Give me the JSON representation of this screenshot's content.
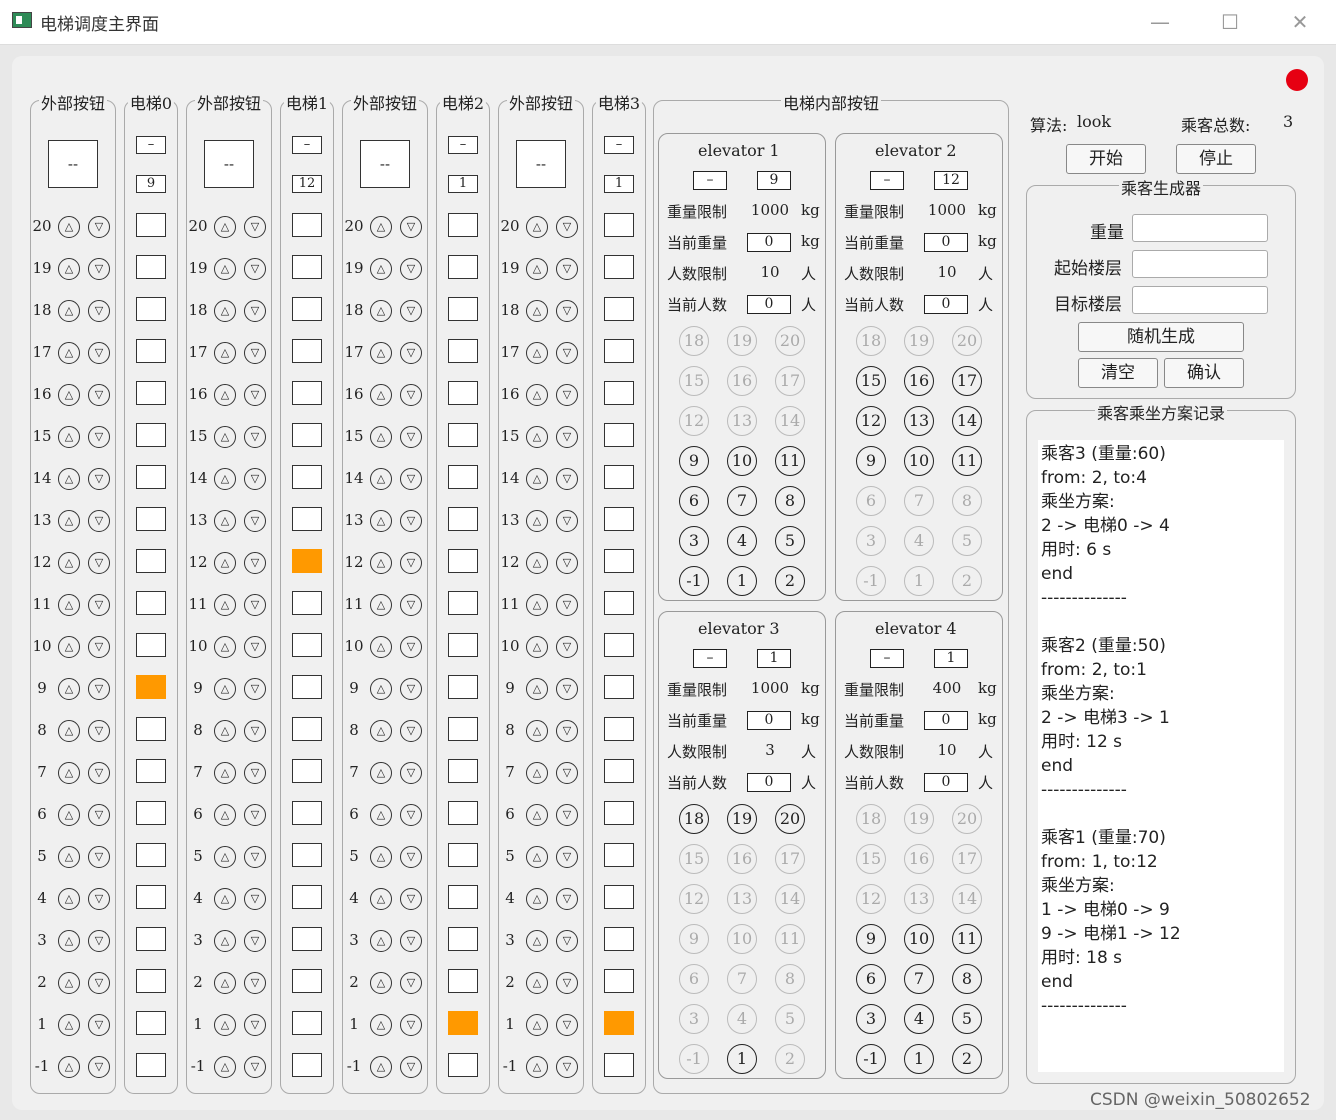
{
  "window": {
    "title": "电梯调度主界面",
    "minimize": "—",
    "maximize": "☐",
    "close": "✕"
  },
  "floors": [
    "20",
    "19",
    "18",
    "17",
    "16",
    "15",
    "14",
    "13",
    "12",
    "11",
    "10",
    "9",
    "8",
    "7",
    "6",
    "5",
    "4",
    "3",
    "2",
    "1",
    "-1"
  ],
  "columns": [
    {
      "outer_label": "外部按钮",
      "outer_display": "--",
      "shaft_label": "电梯0",
      "direction": "–",
      "floor": "9",
      "active_floor": "9"
    },
    {
      "outer_label": "外部按钮",
      "outer_display": "--",
      "shaft_label": "电梯1",
      "direction": "–",
      "floor": "12",
      "active_floor": "12"
    },
    {
      "outer_label": "外部按钮",
      "outer_display": "--",
      "shaft_label": "电梯2",
      "direction": "–",
      "floor": "1",
      "active_floor": "1"
    },
    {
      "outer_label": "外部按钮",
      "outer_display": "--",
      "shaft_label": "电梯3",
      "direction": "–",
      "floor": "1",
      "active_floor": "1"
    }
  ],
  "icons": {
    "up": "up-arrow-circle-icon",
    "down": "down-arrow-circle-icon",
    "status": "red-status-dot"
  },
  "inner": {
    "group_label": "电梯内部按钮",
    "labels": {
      "weight_limit": "重量限制",
      "current_weight": "当前重量",
      "people_limit": "人数限制",
      "current_people": "当前人数",
      "kg": "kg",
      "person": "人"
    },
    "button_rows": [
      [
        "18",
        "19",
        "20"
      ],
      [
        "15",
        "16",
        "17"
      ],
      [
        "12",
        "13",
        "14"
      ],
      [
        "9",
        "10",
        "11"
      ],
      [
        "6",
        "7",
        "8"
      ],
      [
        "3",
        "4",
        "5"
      ],
      [
        "-1",
        "1",
        "2"
      ]
    ],
    "elevators": [
      {
        "name": "elevator 1",
        "direction": "–",
        "floor": "9",
        "weight_limit": "1000",
        "current_weight": "0",
        "people_limit": "10",
        "current_people": "0",
        "enabled": [
          "9",
          "10",
          "11",
          "6",
          "7",
          "8",
          "3",
          "4",
          "5",
          "-1",
          "1",
          "2"
        ]
      },
      {
        "name": "elevator 2",
        "direction": "–",
        "floor": "12",
        "weight_limit": "1000",
        "current_weight": "0",
        "people_limit": "10",
        "current_people": "0",
        "enabled": [
          "15",
          "16",
          "17",
          "12",
          "13",
          "14",
          "9",
          "10",
          "11"
        ]
      },
      {
        "name": "elevator 3",
        "direction": "–",
        "floor": "1",
        "weight_limit": "1000",
        "current_weight": "0",
        "people_limit": "3",
        "current_people": "0",
        "enabled": [
          "18",
          "19",
          "20",
          "1"
        ]
      },
      {
        "name": "elevator 4",
        "direction": "–",
        "floor": "1",
        "weight_limit": "400",
        "current_weight": "0",
        "people_limit": "10",
        "current_people": "0",
        "enabled": [
          "9",
          "10",
          "11",
          "6",
          "7",
          "8",
          "3",
          "4",
          "5",
          "-1",
          "1",
          "2"
        ]
      }
    ]
  },
  "control": {
    "algorithm_label": "算法:",
    "algorithm_value": "look",
    "total_label": "乘客总数:",
    "total_value": "3",
    "start": "开始",
    "stop": "停止"
  },
  "generator": {
    "title": "乘客生成器",
    "weight_label": "重量",
    "start_floor_label": "起始楼层",
    "target_floor_label": "目标楼层",
    "weight_value": "",
    "start_floor_value": "",
    "target_floor_value": "",
    "random": "随机生成",
    "clear": "清空",
    "confirm": "确认"
  },
  "log": {
    "title": "乘客乘坐方案记录",
    "lines": [
      "乘客3 (重量:60)",
      "from: 2, to:4",
      "乘坐方案:",
      "2 -> 电梯0 -> 4",
      "用时: 6 s",
      "end",
      "--------------",
      "",
      "乘客2 (重量:50)",
      "from: 2, to:1",
      "乘坐方案:",
      "2 -> 电梯3 -> 1",
      "用时: 12 s",
      "end",
      "--------------",
      "",
      "乘客1 (重量:70)",
      "from: 1, to:12",
      "乘坐方案:",
      "1 -> 电梯0 -> 9",
      "9 -> 电梯1 -> 12",
      "用时: 18 s",
      "end",
      "--------------"
    ]
  },
  "watermark": "CSDN @weixin_50802652"
}
